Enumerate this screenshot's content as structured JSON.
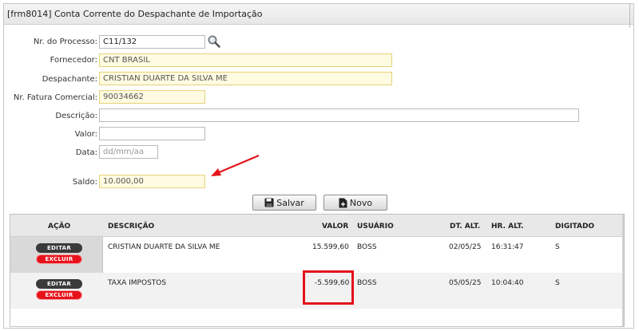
{
  "window": {
    "title": "[frm8014] Conta Corrente do Despachante de Importação"
  },
  "form": {
    "processo": {
      "label": "Nr. do Processo:",
      "value": "C11/132"
    },
    "fornecedor": {
      "label": "Fornecedor:",
      "value": "CNT BRASIL"
    },
    "despachante": {
      "label": "Despachante:",
      "value": "CRISTIAN DUARTE DA SILVA ME"
    },
    "fatura": {
      "label": "Nr. Fatura Comercial:",
      "value": "90034662"
    },
    "descricao": {
      "label": "Descrição:",
      "value": ""
    },
    "valor": {
      "label": "Valor:",
      "value": ""
    },
    "data": {
      "label": "Data:",
      "placeholder": "dd/mm/aa"
    },
    "saldo": {
      "label": "Saldo:",
      "value": "10.000,00"
    }
  },
  "toolbar": {
    "save_label": "Salvar",
    "new_label": "Novo"
  },
  "grid": {
    "columns": [
      "AÇÃO",
      "DESCRIÇÃO",
      "VALOR",
      "USUÁRIO",
      "DT. ALT.",
      "HR. ALT.",
      "DIGITADO"
    ],
    "edit_label": "EDITAR",
    "delete_label": "EXCLUIR",
    "rows": [
      {
        "descricao": "CRISTIAN DUARTE DA SILVA ME",
        "valor": "15.599,60",
        "usuario": "BOSS",
        "dt": "02/05/25",
        "hr": "16:31:47",
        "digitado": "S"
      },
      {
        "descricao": "TAXA IMPOSTOS",
        "valor": "-5.599,60",
        "usuario": "BOSS",
        "dt": "05/05/25",
        "hr": "10:04:40",
        "digitado": "S"
      }
    ]
  },
  "annotations": {
    "arrow_color": "#e3131c",
    "box_color": "#e3131c"
  },
  "icons": {
    "search": "magnifier-icon",
    "save": "floppy-disk-icon",
    "new": "new-document-icon"
  }
}
